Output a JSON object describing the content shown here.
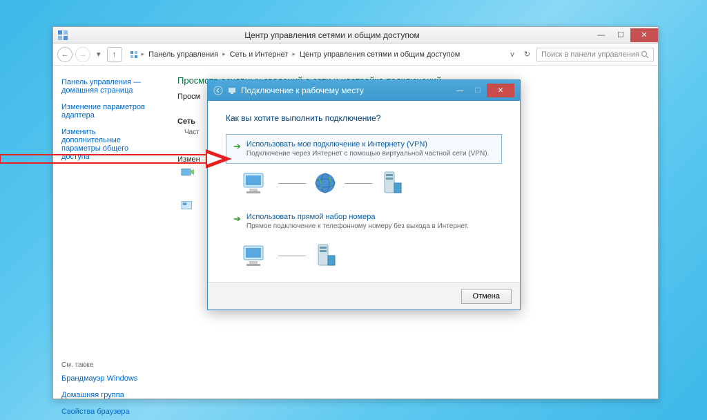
{
  "window": {
    "title": "Центр управления сетями и общим доступом",
    "minimize": "—",
    "maximize": "☐",
    "close": "✕"
  },
  "toolbar": {
    "back": "←",
    "forward": "→",
    "up": "↑",
    "crumbs": [
      "Панель управления",
      "Сеть и Интернет",
      "Центр управления сетями и общим доступом"
    ],
    "search_placeholder": "Поиск в панели управления"
  },
  "sidebar": {
    "links": [
      "Панель управления — домашняя страница",
      "Изменение параметров адаптера",
      "Изменить дополнительные параметры общего доступа"
    ],
    "see_also_label": "См. также",
    "see_also": [
      "Брандмауэр Windows",
      "Домашняя группа",
      "Свойства браузера"
    ]
  },
  "main": {
    "heading": "Просмотр основных сведений о сети и настройка подключений",
    "stub1": "Просм",
    "stub2_label": "Сеть",
    "stub2_line": "Част",
    "stub3": "Измен"
  },
  "dialog": {
    "title": "Подключение к рабочему месту",
    "minimize": "—",
    "maximize": "☐",
    "close": "✕",
    "heading": "Как вы хотите выполнить подключение?",
    "options": [
      {
        "title": "Использовать мое подключение к Интернету (VPN)",
        "desc": "Подключение через Интернет с помощью виртуальной частной сети (VPN)."
      },
      {
        "title": "Использовать прямой набор номера",
        "desc": "Прямое подключение к телефонному номеру без выхода в Интернет."
      }
    ],
    "cancel": "Отмена"
  }
}
